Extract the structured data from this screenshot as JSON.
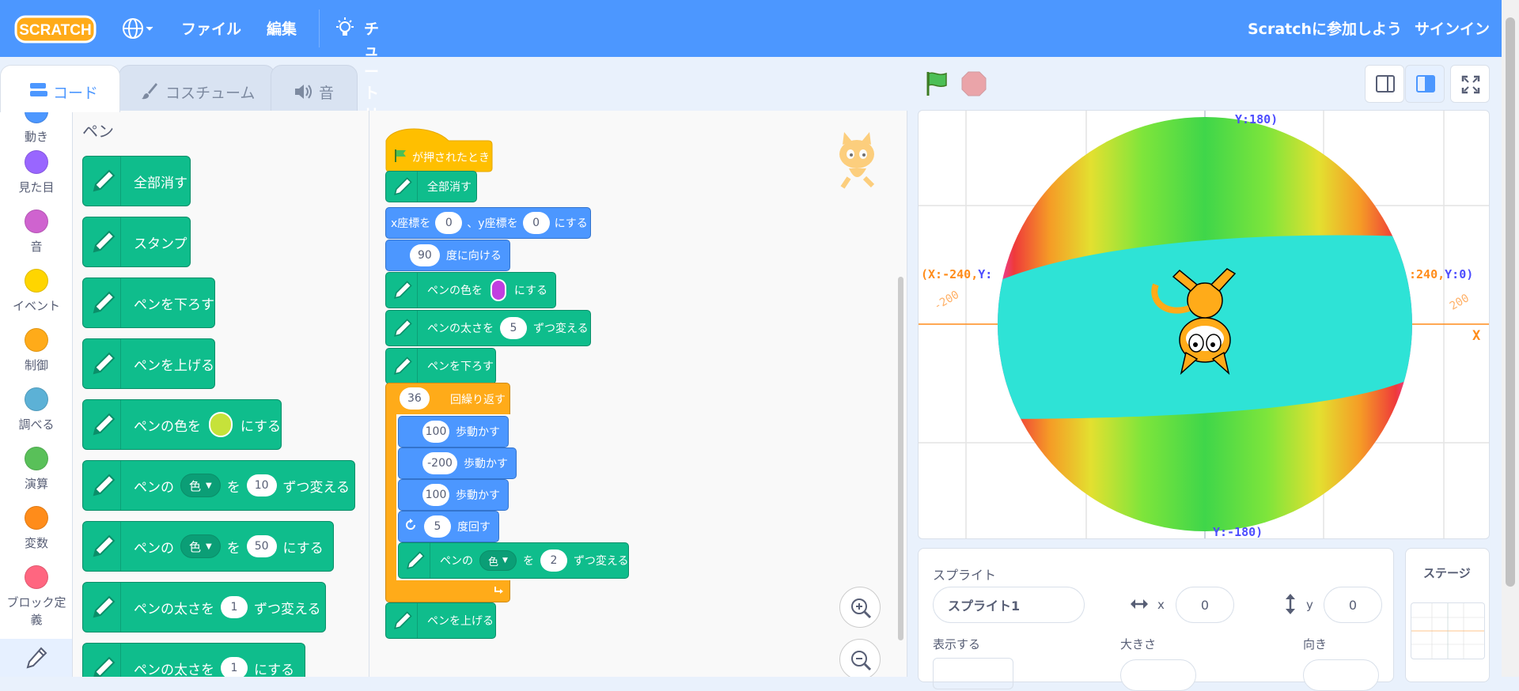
{
  "menubar": {
    "logo": "SCRATCH",
    "file": "ファイル",
    "edit": "編集",
    "tutorials": "チュートリアル",
    "join": "Scratchに参加しよう",
    "signin": "サインイン"
  },
  "tabs": {
    "code": "コード",
    "costumes": "コスチューム",
    "sounds": "音"
  },
  "categories": [
    {
      "label": "動き",
      "color": "#4c97ff"
    },
    {
      "label": "見た目",
      "color": "#9966ff"
    },
    {
      "label": "音",
      "color": "#cf63cf"
    },
    {
      "label": "イベント",
      "color": "#ffd500"
    },
    {
      "label": "制御",
      "color": "#ffab19"
    },
    {
      "label": "調べる",
      "color": "#5cb1d6"
    },
    {
      "label": "演算",
      "color": "#59c059"
    },
    {
      "label": "変数",
      "color": "#ff8c1a"
    },
    {
      "label": "ブロック定義",
      "color": "#ff6680"
    }
  ],
  "palette": {
    "heading": "ペン",
    "clear": "全部消す",
    "stamp": "スタンプ",
    "pen_down": "ペンを下ろす",
    "pen_up": "ペンを上げる",
    "set_color_a": "ペンの色を",
    "set_color_b": "にする",
    "set_color_value": "#c6e23a",
    "change_param_a": "ペンの",
    "param_name": "色",
    "change_param_b": "を",
    "change_param_value": "10",
    "change_param_c": "ずつ変える",
    "set_param_value": "50",
    "set_param_c": "にする",
    "change_size_a": "ペンの太さを",
    "change_size_value": "1",
    "change_size_b": "ずつ変える",
    "set_size_a": "ペンの太さを",
    "set_size_value": "1",
    "set_size_b": "にする"
  },
  "script": {
    "hat": "が押されたとき",
    "clear": "全部消す",
    "goto_a": "x座標を",
    "goto_x": "0",
    "goto_b": "、y座標を",
    "goto_y": "0",
    "goto_c": "にする",
    "dir_value": "90",
    "dir_label": "度に向ける",
    "setcolor_a": "ペンの色を",
    "setcolor_value": "#c13ee0",
    "setcolor_b": "にする",
    "size_a": "ペンの太さを",
    "size_value": "5",
    "size_b": "ずつ変える",
    "pendown": "ペンを下ろす",
    "repeat_value": "36",
    "repeat_label": "回繰り返す",
    "move1_value": "100",
    "move_label": "歩動かす",
    "move2_value": "-200",
    "move3_value": "100",
    "turn_value": "5",
    "turn_label": "度回す",
    "change_a": "ペンの",
    "change_param": "色",
    "change_b": "を",
    "change_value": "2",
    "change_c": "ずつ変える",
    "penup": "ペンを上げる"
  },
  "stage": {
    "top_label": "Y:180)",
    "bottom_label": "Y:-180)",
    "left_label_x": "(X:-240,",
    "left_label_y": "Y:",
    "right_label_x": ":240,",
    "right_label_y": "Y:0)",
    "left_tick": "-200",
    "right_tick": "200",
    "x_axis": "X"
  },
  "sprite_info": {
    "heading": "スプライト",
    "name": "スプライト1",
    "x_label": "x",
    "x_value": "0",
    "y_label": "y",
    "y_value": "0",
    "show_label": "表示する",
    "size_label": "大きさ",
    "dir_label": "向き"
  },
  "stage_pane": {
    "heading": "ステージ"
  }
}
